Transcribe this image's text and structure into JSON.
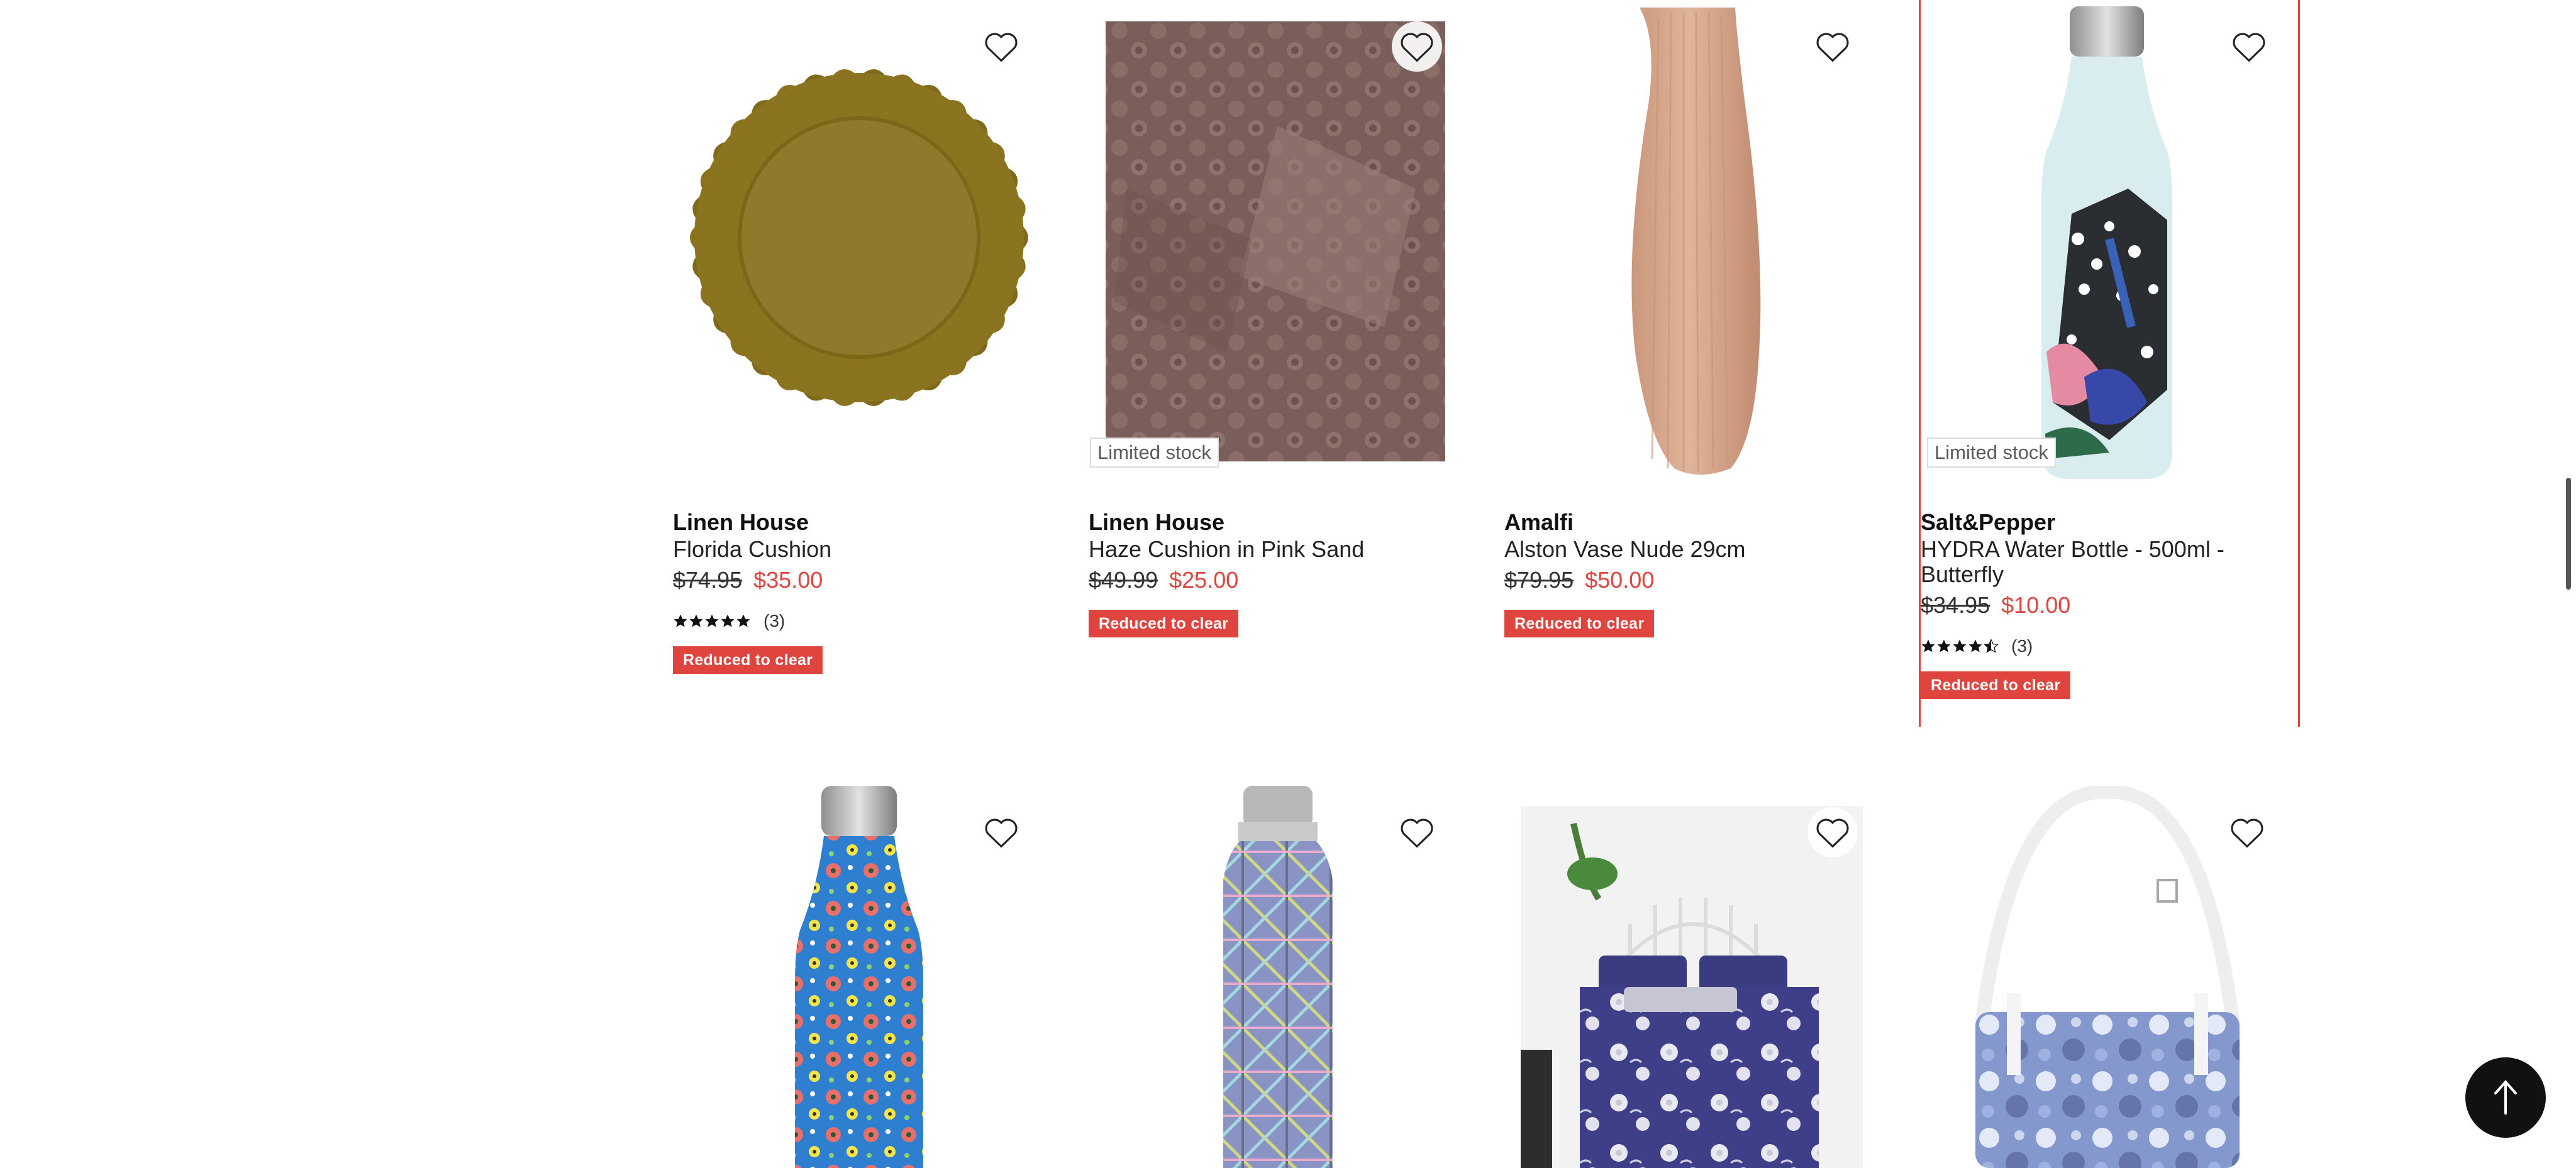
{
  "products": [
    {
      "brand": "Linen House",
      "name": "Florida Cushion",
      "was_price": "$74.95",
      "now_price": "$35.00",
      "rating_count": "(3)",
      "rating": 5,
      "badge": "Reduced to clear"
    },
    {
      "brand": "Linen House",
      "name": "Haze Cushion in Pink Sand",
      "was_price": "$49.99",
      "now_price": "$25.00",
      "limited_label": "Limited stock",
      "badge": "Reduced to clear"
    },
    {
      "brand": "Amalfi",
      "name": "Alston Vase Nude 29cm",
      "was_price": "$79.95",
      "now_price": "$50.00",
      "badge": "Reduced to clear"
    },
    {
      "brand": "Salt&Pepper",
      "name": "HYDRA Water Bottle - 500ml - Butterfly",
      "was_price": "$34.95",
      "now_price": "$10.00",
      "limited_label": "Limited stock",
      "rating_count": "(3)",
      "rating": 4.5,
      "badge": "Reduced to clear"
    }
  ],
  "icons": {
    "wishlist": "heart-outline-icon",
    "back_to_top": "arrow-up-icon",
    "star": "star-icon"
  },
  "colors": {
    "sale_red": "#e0443f",
    "badge_text": "#ffffff",
    "back_to_top_bg": "#111111"
  }
}
